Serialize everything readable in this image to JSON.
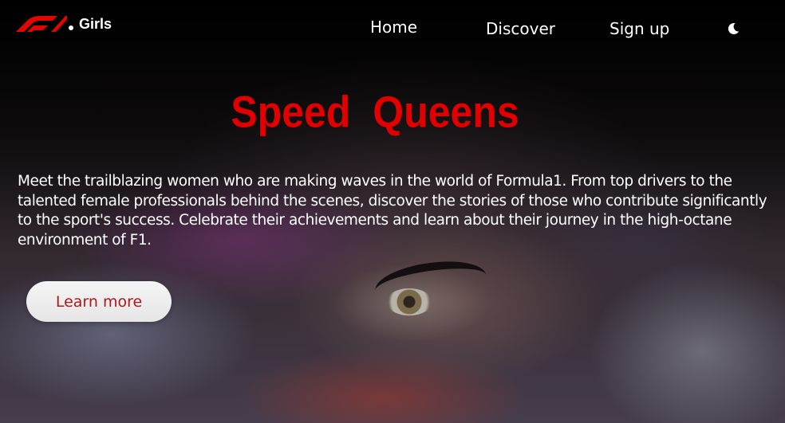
{
  "brand": {
    "logo_icon": "f1-logo-icon",
    "name": "Girls",
    "logo_color": "#e10600"
  },
  "nav": {
    "items": [
      {
        "label": "Home"
      },
      {
        "label": "Discover"
      },
      {
        "label": "Sign up"
      }
    ],
    "theme_toggle_icon": "moon-icon"
  },
  "hero": {
    "title": "Speed  Queens",
    "title_color": "#e00000",
    "description": "Meet the trailblazing women who are making waves in the world of Formula1. From top drivers to the talented female professionals behind the scenes, discover the stories of those who contribute significantly to the sport's success. Celebrate their achievements and learn about their journey in the high-octane environment of F1.",
    "cta_label": "Learn more",
    "cta_text_color": "#b01818"
  }
}
